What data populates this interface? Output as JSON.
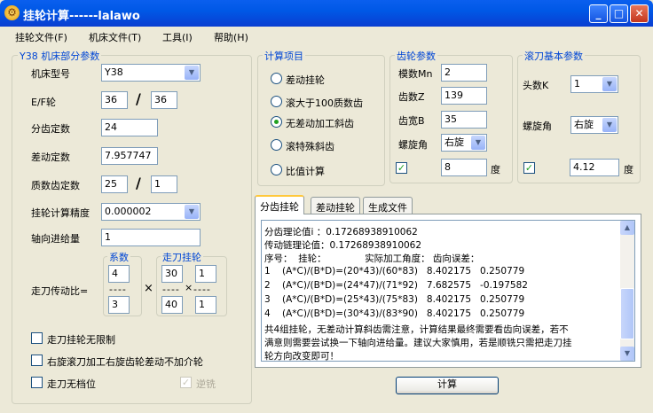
{
  "window": {
    "title": "挂轮计算------lalawo",
    "app_icon": "gear-icon",
    "controls": [
      "minimize-icon",
      "maximize-icon",
      "close-icon"
    ]
  },
  "menu": [
    "挂轮文件(F)",
    "机床文件(T)",
    "工具(I)",
    "帮助(H)"
  ],
  "machine": {
    "group_title": "Y38 机床部分参数",
    "model_label": "机床型号",
    "model_value": "Y38",
    "ef_label": "E/F轮",
    "e_value": "36",
    "f_value": "36",
    "slash": "/",
    "index_const_label": "分齿定数",
    "index_const_value": "24",
    "diff_const_label": "差动定数",
    "diff_const_value": "7.957747",
    "prime_const_label": "质数齿定数",
    "prime_a_value": "25",
    "prime_b_value": "1",
    "precision_label": "挂轮计算精度",
    "precision_value": "0.000002",
    "axial_feed_label": "轴向进给量",
    "axial_feed_value": "1",
    "ratio_label": "走刀传动比=",
    "coef_title": "系数",
    "coef_top": "4",
    "coef_bottom": "3",
    "dash": "----",
    "times": "×",
    "feed_gear_title": "走刀挂轮",
    "feed_a": "30",
    "feed_b": "1",
    "feed_c": "40",
    "feed_d": "1",
    "checks": [
      {
        "label": "走刀挂轮无限制",
        "checked": false,
        "disabled": false
      },
      {
        "label": "右旋滚刀加工右旋齿轮差动不加介轮",
        "checked": false,
        "disabled": false
      },
      {
        "label": "走刀无档位",
        "checked": false,
        "disabled": false
      },
      {
        "label": "逆铣",
        "checked": true,
        "disabled": true
      }
    ]
  },
  "calc_items": {
    "group_title": "计算项目",
    "options": [
      {
        "label": "差动挂轮",
        "selected": false
      },
      {
        "label": "滚大于100质数齿",
        "selected": false
      },
      {
        "label": "无差动加工斜齿",
        "selected": true
      },
      {
        "label": "滚特殊斜齿",
        "selected": false
      },
      {
        "label": "比值计算",
        "selected": false
      }
    ]
  },
  "gear": {
    "group_title": "齿轮参数",
    "module_label": "模数Mn",
    "module_value": "2",
    "teeth_label": "齿数Z",
    "teeth_value": "139",
    "width_label": "齿宽B",
    "width_value": "35",
    "helix_dir_label": "螺旋角",
    "helix_dir_value": "右旋",
    "helix_checked": true,
    "helix_angle_value": "8",
    "degree_unit": "度"
  },
  "hob": {
    "group_title": "滚刀基本参数",
    "starts_label": "头数K",
    "starts_value": "1",
    "helix_dir_label": "螺旋角",
    "helix_dir_value": "右旋",
    "angle_checked": true,
    "angle_value": "4.12",
    "degree_unit": "度"
  },
  "tabs": [
    {
      "label": "分齿挂轮",
      "active": true
    },
    {
      "label": "差动挂轮",
      "active": false
    },
    {
      "label": "生成文件",
      "active": false
    }
  ],
  "result_lines": [
    "分齿理论值i ：0.17268938910062",
    "传动链理论值：0.17268938910062",
    "序号：  挂轮：             实际加工角度： 齿向误差：",
    "1    (A*C)/(B*D)=(20*43)/(60*83)   8.402175   0.250779",
    "2    (A*C)/(B*D)=(24*47)/(71*92)   7.682575   -0.197582",
    "3    (A*C)/(B*D)=(25*43)/(75*83)   8.402175   0.250779",
    "4    (A*C)/(B*D)=(30*43)/(83*90)   8.402175   0.250779",
    "共4组挂轮，无差动计算斜齿需注意，计算结果最终需要看齿向误差，若不",
    "满意则需要尝试换一下轴向进给量。建议大家慎用，若是顺铣只需把走刀挂",
    "轮方向改变即可！"
  ],
  "calc_button": "计算"
}
